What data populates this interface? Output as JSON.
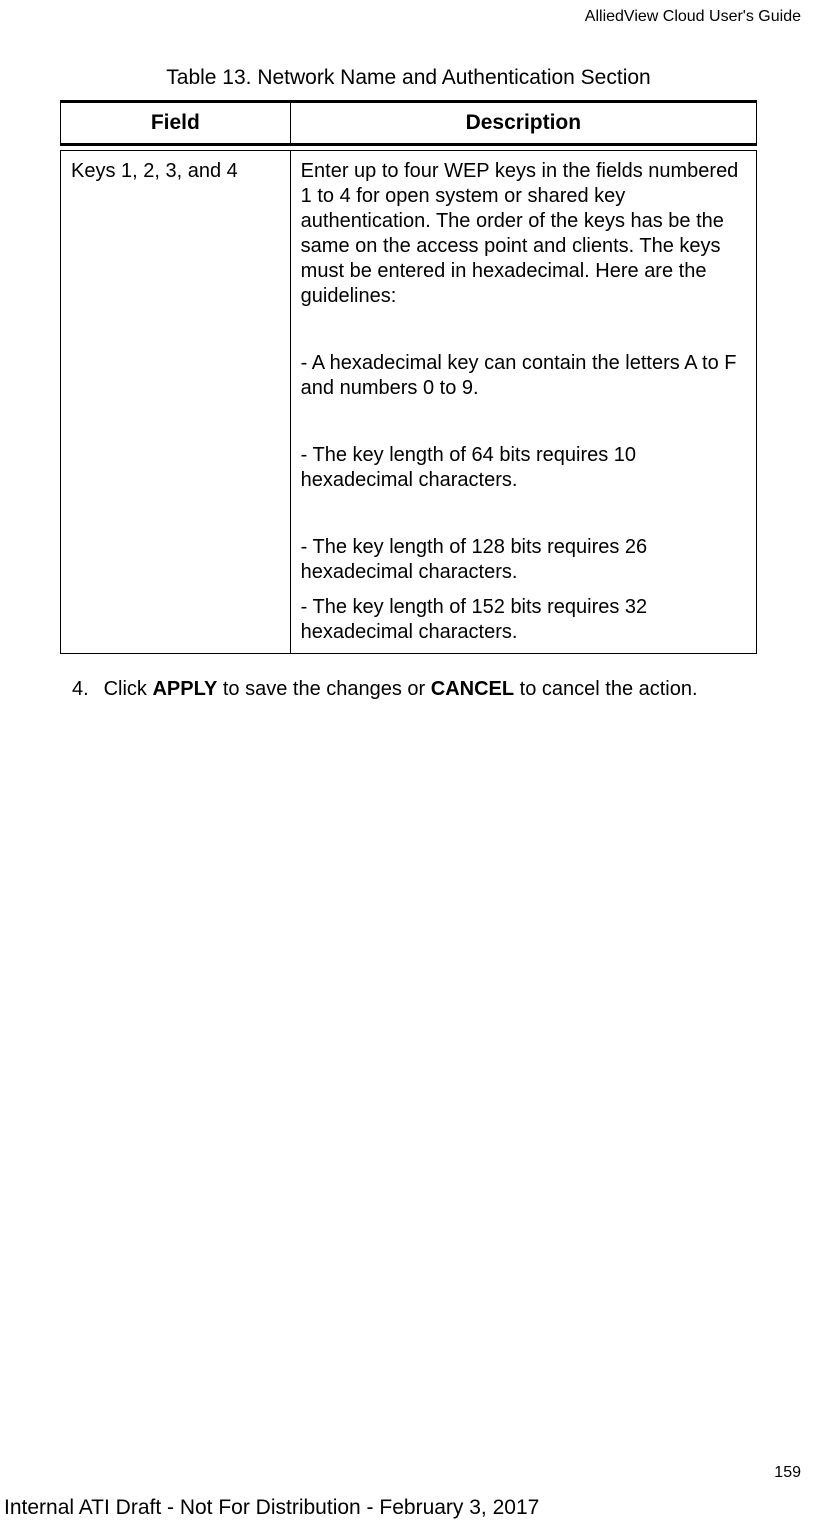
{
  "header": {
    "doc_title": "AlliedView Cloud User's Guide"
  },
  "table": {
    "caption": "Table 13. Network Name and Authentication Section",
    "headers": {
      "field": "Field",
      "description": "Description"
    },
    "row": {
      "field": "Keys 1, 2, 3, and 4",
      "desc_p1": "Enter up to four WEP keys in the fields numbered 1 to 4 for open system or shared key authentication. The order of the keys has be the same on the access point and clients. The keys must be entered in hexadecimal. Here are the guidelines:",
      "desc_p2": "- A hexadecimal key can contain the letters A to F and numbers 0 to 9.",
      "desc_p3": "- The key length of 64 bits requires 10 hexadecimal characters.",
      "desc_p4": "- The key length of 128 bits requires 26 hexadecimal characters.",
      "desc_p5": "- The key length of 152 bits requires 32 hexadecimal characters."
    }
  },
  "instruction": {
    "number": "4.",
    "prefix": "Click ",
    "bold1": "APPLY",
    "mid": " to save the changes or ",
    "bold2": "CANCEL",
    "suffix": " to cancel the action."
  },
  "page_number": "159",
  "footer": "Internal ATI Draft - Not For Distribution - February 3, 2017"
}
